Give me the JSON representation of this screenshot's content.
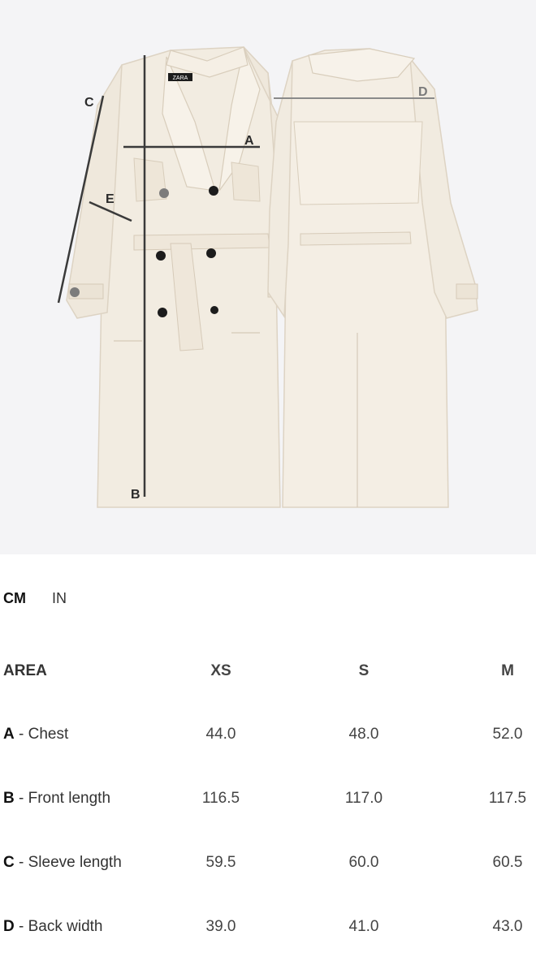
{
  "image": {
    "brand_tag": "ZARA",
    "markers": {
      "a": "A",
      "b": "B",
      "c": "C",
      "d": "D",
      "e": "E"
    }
  },
  "unit_toggle": {
    "active": "CM",
    "inactive": "IN"
  },
  "size_table": {
    "header": {
      "area": "AREA",
      "sizes": [
        "XS",
        "S",
        "M"
      ]
    },
    "rows": [
      {
        "code": "A",
        "name": " - Chest",
        "values": [
          "44.0",
          "48.0",
          "52.0"
        ]
      },
      {
        "code": "B",
        "name": " - Front length",
        "values": [
          "116.5",
          "117.0",
          "117.5"
        ]
      },
      {
        "code": "C",
        "name": " - Sleeve length",
        "values": [
          "59.5",
          "60.0",
          "60.5"
        ]
      },
      {
        "code": "D",
        "name": " - Back width",
        "values": [
          "39.0",
          "41.0",
          "43.0"
        ]
      }
    ]
  },
  "colors": {
    "background": "#f4f4f6",
    "coat": "#f3ede2",
    "measure_line": "#3a3a3a"
  }
}
